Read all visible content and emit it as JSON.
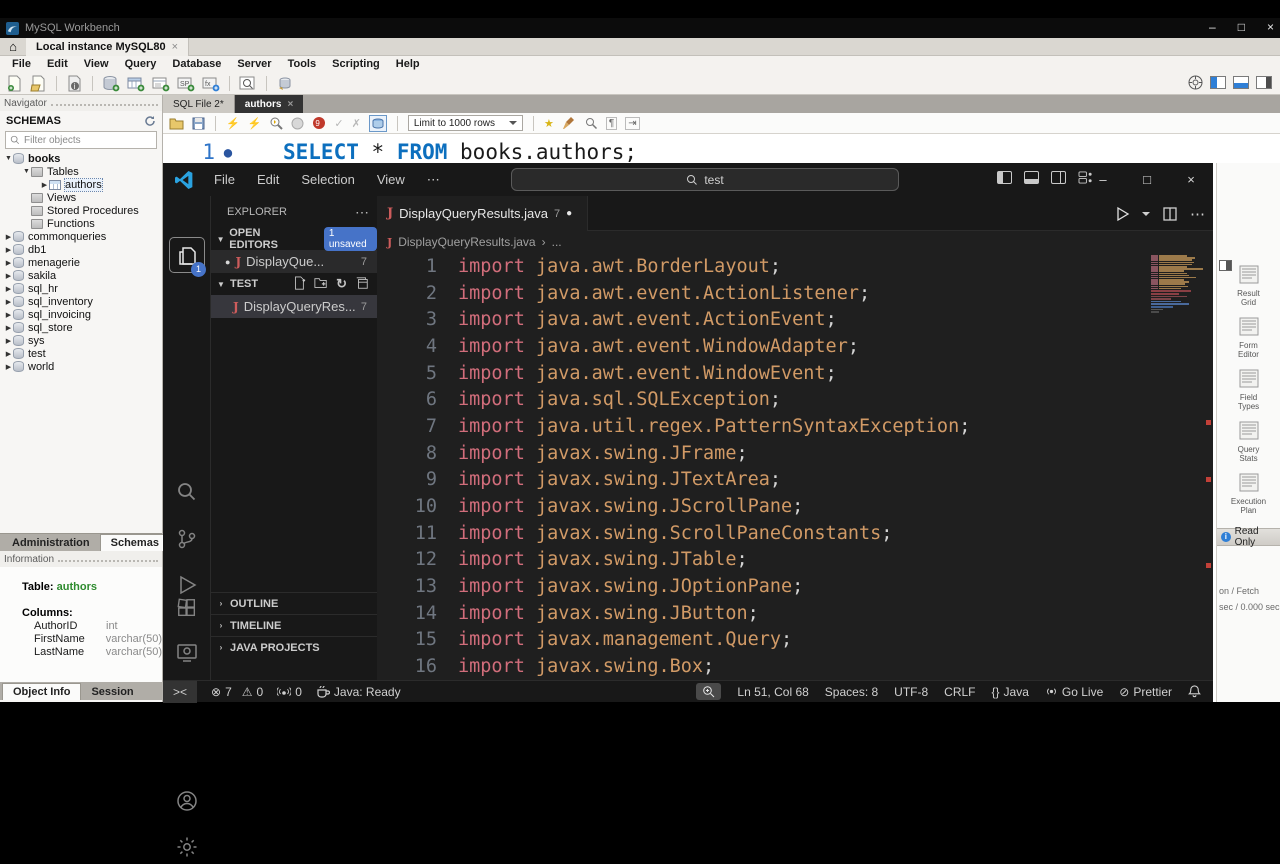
{
  "colors": {
    "badge_blue": "#4673c8",
    "keyword_pink": "#d16d7b",
    "path_orange": "#d19a66",
    "wb_keyword_blue": "#0c6fbe",
    "error_red": "#c24038",
    "java_icon_red": "#cd5c5c",
    "table_green": "#2e8b2e",
    "vscode_bg": "#1f1f1f",
    "wb_bg": "#f2f1ee"
  },
  "glyphs": {
    "close": "×",
    "minimize": "–",
    "maximize": "□",
    "more_h": "⋯",
    "ellipsis": "...",
    "chevron_right": "›",
    "back": "←",
    "forward": "→",
    "expanded": "▼",
    "collapsed": "▶",
    "refresh": "↻",
    "bolt": "⚡",
    "check": "✓",
    "cross": "✗",
    "star": "★",
    "pilcrow": "¶",
    "tab_arrow": "⇥",
    "error": "⊗",
    "warning": "⚠",
    "slash": "⊘",
    "dot": "●",
    "remote": "><",
    "braces": "{}",
    "home": "⌂",
    "sb_chevron": "❯",
    "sec_chevron": "›"
  },
  "workbench": {
    "window_title": "MySQL Workbench",
    "connection_tab": "Local instance MySQL80",
    "menus": [
      "File",
      "Edit",
      "View",
      "Query",
      "Database",
      "Server",
      "Tools",
      "Scripting",
      "Help"
    ],
    "navigator": {
      "panel_label": "Navigator",
      "section_label": "SCHEMAS",
      "filter_placeholder": "Filter objects",
      "tree": [
        {
          "label": "books",
          "indent": 0,
          "state": "expanded",
          "icon": "db",
          "bold": true
        },
        {
          "label": "Tables",
          "indent": 1,
          "state": "expanded",
          "icon": "folder"
        },
        {
          "label": "authors",
          "indent": 2,
          "state": "collapsed",
          "icon": "table",
          "selected": true
        },
        {
          "label": "Views",
          "indent": 1,
          "state": "none",
          "icon": "folder"
        },
        {
          "label": "Stored Procedures",
          "indent": 1,
          "state": "none",
          "icon": "folder"
        },
        {
          "label": "Functions",
          "indent": 1,
          "state": "none",
          "icon": "folder"
        },
        {
          "label": "commonqueries",
          "indent": 0,
          "state": "collapsed",
          "icon": "db"
        },
        {
          "label": "db1",
          "indent": 0,
          "state": "collapsed",
          "icon": "db"
        },
        {
          "label": "menagerie",
          "indent": 0,
          "state": "collapsed",
          "icon": "db"
        },
        {
          "label": "sakila",
          "indent": 0,
          "state": "collapsed",
          "icon": "db"
        },
        {
          "label": "sql_hr",
          "indent": 0,
          "state": "collapsed",
          "icon": "db"
        },
        {
          "label": "sql_inventory",
          "indent": 0,
          "state": "collapsed",
          "icon": "db"
        },
        {
          "label": "sql_invoicing",
          "indent": 0,
          "state": "collapsed",
          "icon": "db"
        },
        {
          "label": "sql_store",
          "indent": 0,
          "state": "collapsed",
          "icon": "db"
        },
        {
          "label": "sys",
          "indent": 0,
          "state": "collapsed",
          "icon": "db"
        },
        {
          "label": "test",
          "indent": 0,
          "state": "collapsed",
          "icon": "db"
        },
        {
          "label": "world",
          "indent": 0,
          "state": "collapsed",
          "icon": "db"
        }
      ],
      "tabs": [
        {
          "label": "Administration",
          "active": false
        },
        {
          "label": "Schemas",
          "active": true
        }
      ]
    },
    "information": {
      "panel_label": "Information",
      "table_label": "Table:",
      "table_name": "authors",
      "columns_label": "Columns:",
      "columns": [
        {
          "name": "AuthorID",
          "type": "int"
        },
        {
          "name": "FirstName",
          "type": "varchar(50)"
        },
        {
          "name": "LastName",
          "type": "varchar(50)"
        }
      ]
    },
    "bottom_tabs": [
      {
        "label": "Object Info",
        "active": true
      },
      {
        "label": "Session",
        "active": false
      }
    ],
    "sql_editor": {
      "tabs": [
        {
          "label": "SQL File 2*",
          "active": false
        },
        {
          "label": "authors",
          "active": true
        }
      ],
      "limit_dropdown": "Limit to 1000 rows",
      "query": {
        "line_number": "1",
        "select_kw": "SELECT",
        "star": "* ",
        "from_kw": "FROM",
        "rest": " books.authors;"
      }
    },
    "result_sidebar": {
      "items": [
        "Result Grid",
        "Form Editor",
        "Field Types",
        "Query Stats",
        "Execution Plan"
      ],
      "read_only": "Read Only",
      "partial_line1": "on / Fetch",
      "partial_line2": "sec / 0.000 sec"
    }
  },
  "vscode": {
    "menus": [
      "File",
      "Edit",
      "Selection",
      "View",
      "⋯"
    ],
    "search_value": "test",
    "explorer": {
      "title": "EXPLORER",
      "open_editors": {
        "label": "OPEN EDITORS",
        "badge": "1 unsaved",
        "item": {
          "name": "DisplayQue...",
          "problems": "7"
        }
      },
      "folder": {
        "label": "TEST",
        "item": {
          "name": "DisplayQueryRes...",
          "problems": "7"
        }
      },
      "sections": [
        "OUTLINE",
        "TIMELINE",
        "JAVA PROJECTS"
      ]
    },
    "editor": {
      "tab_name": "DisplayQueryResults.java",
      "tab_problems": "7",
      "breadcrumb_file": "DisplayQueryResults.java",
      "breadcrumb_more": "...",
      "keyword": "import",
      "semicolon": ";",
      "lines": [
        {
          "num": "1",
          "path": "java.awt.BorderLayout"
        },
        {
          "num": "2",
          "path": "java.awt.event.ActionListener"
        },
        {
          "num": "3",
          "path": "java.awt.event.ActionEvent"
        },
        {
          "num": "4",
          "path": "java.awt.event.WindowAdapter"
        },
        {
          "num": "5",
          "path": "java.awt.event.WindowEvent"
        },
        {
          "num": "6",
          "path": "java.sql.SQLException"
        },
        {
          "num": "7",
          "path": "java.util.regex.PatternSyntaxException"
        },
        {
          "num": "8",
          "path": "javax.swing.JFrame"
        },
        {
          "num": "9",
          "path": "javax.swing.JTextArea"
        },
        {
          "num": "10",
          "path": "javax.swing.JScrollPane"
        },
        {
          "num": "11",
          "path": "javax.swing.ScrollPaneConstants"
        },
        {
          "num": "12",
          "path": "javax.swing.JTable"
        },
        {
          "num": "13",
          "path": "javax.swing.JOptionPane"
        },
        {
          "num": "14",
          "path": "javax.swing.JButton"
        },
        {
          "num": "15",
          "path": "javax.management.Query"
        },
        {
          "num": "16",
          "path": "javax.swing.Box"
        }
      ]
    },
    "status_bar": {
      "errors": "7",
      "warnings": "0",
      "ports": "0",
      "java_status": "Java: Ready",
      "cursor": "Ln 51, Col 68",
      "spaces": "Spaces: 8",
      "encoding": "UTF-8",
      "eol": "CRLF",
      "language": "Java",
      "go_live": "Go Live",
      "prettier": "Prettier"
    }
  }
}
